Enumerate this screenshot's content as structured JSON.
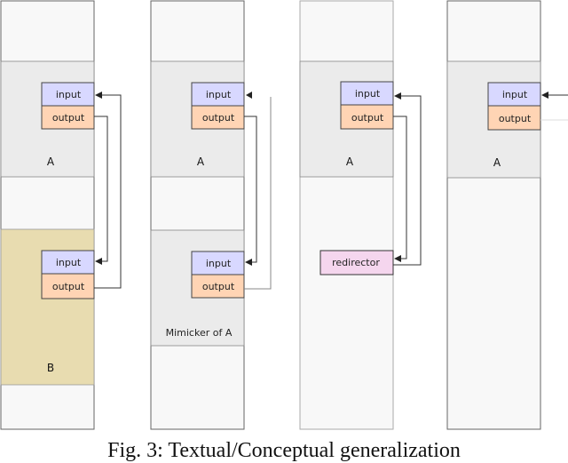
{
  "figure": {
    "caption": "Fig. 3: Textual/Conceptual generalization",
    "colors": {
      "column_bg": "#f8f8f8",
      "segment_a": "#ebebeb",
      "segment_b": "#e8dcb0",
      "input_box": "#d8d8ff",
      "output_box": "#ffd4b4",
      "redirector_box": "#f5d6ee"
    },
    "panels": [
      {
        "segments": [
          {
            "label": "A",
            "input": "input",
            "output": "output"
          },
          {
            "label": "B",
            "input": "input",
            "output": "output"
          }
        ]
      },
      {
        "segments": [
          {
            "label": "A",
            "input": "input",
            "output": "output"
          },
          {
            "label": "Mimicker of A",
            "input": "input",
            "output": "output"
          }
        ]
      },
      {
        "segments": [
          {
            "label": "A",
            "input": "input",
            "output": "output"
          }
        ],
        "redirector": "redirector"
      },
      {
        "segments": [
          {
            "label": "A",
            "input": "input",
            "output": "output"
          }
        ]
      }
    ]
  }
}
